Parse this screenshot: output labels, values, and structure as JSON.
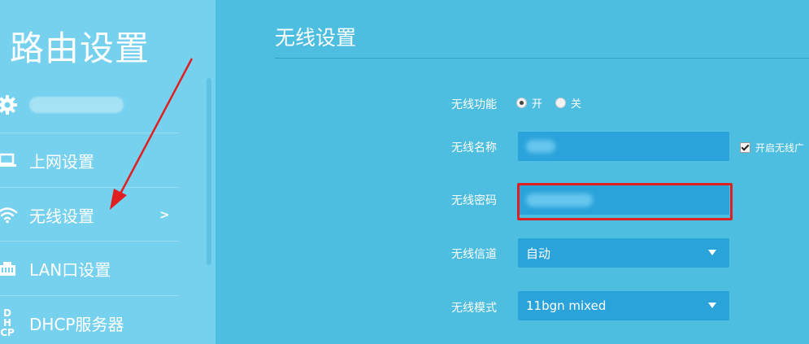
{
  "sidebar": {
    "title": "路由设置",
    "items": [
      {
        "label": "",
        "icon": "gear-icon"
      },
      {
        "label": "上网设置",
        "icon": "laptop-icon"
      },
      {
        "label": "无线设置",
        "icon": "wifi-icon",
        "active": true,
        "arrow": ">"
      },
      {
        "label": "LAN口设置",
        "icon": "ethernet-port-icon"
      },
      {
        "label": "DHCP服务器",
        "icon": "dhcp-icon",
        "icon_text": "DH CP"
      }
    ]
  },
  "main": {
    "title": "无线设置",
    "wireless_function": {
      "label": "无线功能",
      "on": "开",
      "off": "关",
      "selected": "开"
    },
    "ssid": {
      "label": "无线名称",
      "value": "",
      "broadcast_label": "开启无线广"
    },
    "password": {
      "label": "无线密码",
      "value": ""
    },
    "channel": {
      "label": "无线信道",
      "value": "自动"
    },
    "mode": {
      "label": "无线模式",
      "value": "11bgn mixed"
    }
  },
  "colors": {
    "sidebar_bg": "#76d1ef",
    "main_bg": "#4dbde0",
    "field_bg": "#2aa3da",
    "highlight": "#e02020"
  }
}
